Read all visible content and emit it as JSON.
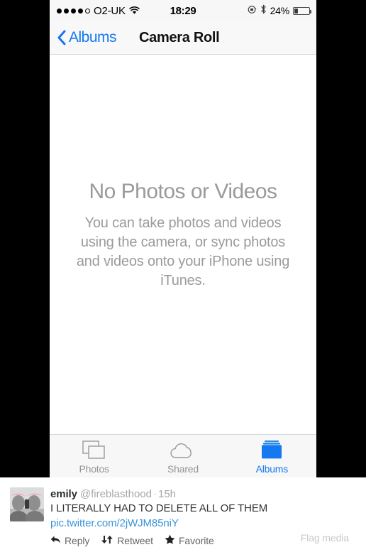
{
  "phone": {
    "status_bar": {
      "signal_dots_filled": 4,
      "signal_dots_total": 5,
      "carrier": "O2-UK",
      "wifi_icon": "wifi-icon",
      "time": "18:29",
      "rotation_lock_icon": "rotation-lock-icon",
      "bluetooth_icon": "bluetooth-icon",
      "battery_percent": "24%",
      "battery_level": 24
    },
    "nav_bar": {
      "back_icon": "chevron-left-icon",
      "back_label": "Albums",
      "title": "Camera Roll"
    },
    "empty_state": {
      "title": "No Photos or Videos",
      "body": "You can take photos and videos using the camera, or sync photos and videos onto your iPhone using iTunes."
    },
    "tab_bar": {
      "items": [
        {
          "label": "Photos",
          "icon": "photos-stack-icon",
          "active": false
        },
        {
          "label": "Shared",
          "icon": "cloud-icon",
          "active": false
        },
        {
          "label": "Albums",
          "icon": "albums-folder-icon",
          "active": true
        }
      ],
      "active_color": "#1478f0",
      "inactive_color": "#949494"
    }
  },
  "tweet": {
    "avatar_alt": "avatar",
    "display_name": "emily",
    "handle": "@fireblasthood",
    "separator": "·",
    "timestamp": "15h",
    "text": "I LITERALLY HAD TO DELETE ALL OF THEM",
    "link": "pic.twitter.com/2jWJM85niY",
    "link_color": "#3b94d9",
    "actions": [
      {
        "label": "Reply",
        "icon": "reply-arrow-icon"
      },
      {
        "label": "Retweet",
        "icon": "retweet-icon"
      },
      {
        "label": "Favorite",
        "icon": "star-icon"
      }
    ],
    "flag_media": "Flag media"
  }
}
